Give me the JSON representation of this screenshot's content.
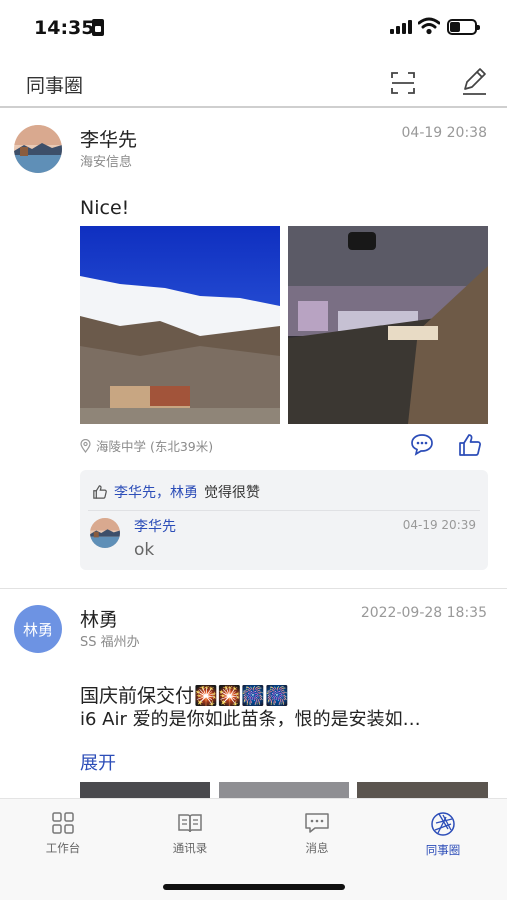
{
  "status_bar": {
    "time": "14:35"
  },
  "nav": {
    "title": "同事圈"
  },
  "posts": [
    {
      "author": "李华先",
      "department": "海安信息",
      "time": "04-19 20:38",
      "text": "Nice!",
      "location": "海陵中学 (东北39米)",
      "likes": {
        "names": "李华先，林勇",
        "suffix": "觉得很赞"
      },
      "comments": [
        {
          "author": "李华先",
          "time": "04-19 20:39",
          "text": "ok"
        }
      ]
    },
    {
      "author": "林勇",
      "avatar_text": "林勇",
      "department": "SS 福州办",
      "time": "2022-09-28 18:35",
      "text_line1": "国庆前保交付🎇🎇🎆🎆",
      "text_line2": "i6 Air 爱的是你如此苗条，恨的是安装如…",
      "expand_label": "展开"
    }
  ],
  "tabs": [
    {
      "label": "工作台",
      "icon": "grid-icon",
      "active": false
    },
    {
      "label": "通讯录",
      "icon": "book-icon",
      "active": false
    },
    {
      "label": "消息",
      "icon": "message-icon",
      "active": false
    },
    {
      "label": "同事圈",
      "icon": "aperture-icon",
      "active": true
    }
  ],
  "colors": {
    "accent": "#2c4db8",
    "avatar_blue": "#6d93e3",
    "box_bg": "#f2f3f5"
  }
}
